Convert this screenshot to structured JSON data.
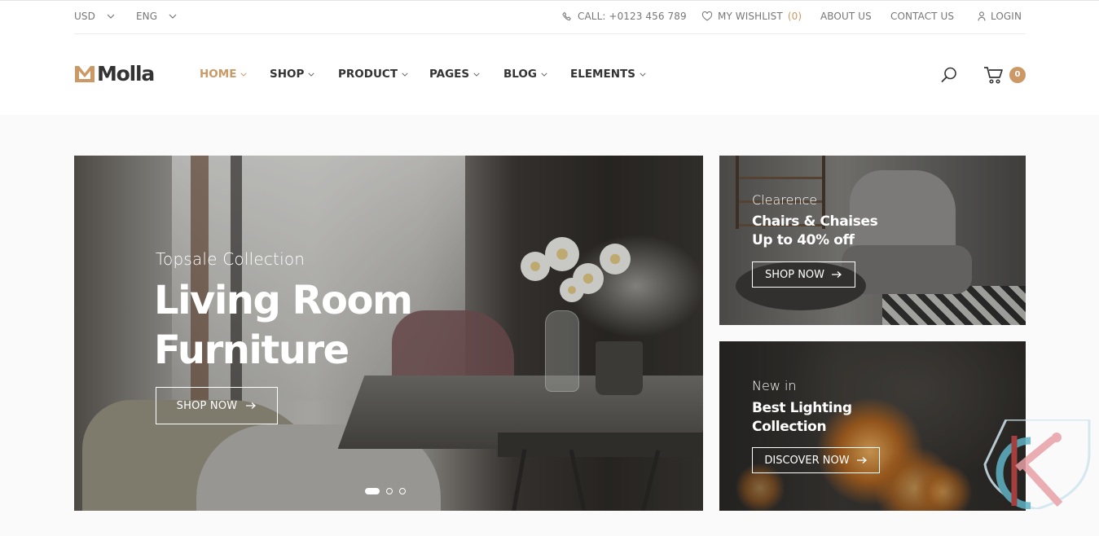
{
  "topbar": {
    "currency": "USD",
    "language": "ENG",
    "call_label": "CALL: +0123 456 789",
    "wishlist_label": "MY WISHLIST",
    "wishlist_count": "(0)",
    "about": "ABOUT US",
    "contact": "CONTACT US",
    "login": "LOGIN"
  },
  "header": {
    "logo_text": "Molla",
    "nav": [
      "HOME",
      "SHOP",
      "PRODUCT",
      "PAGES",
      "BLOG",
      "ELEMENTS"
    ],
    "cart_count": "0"
  },
  "hero": {
    "subtitle": "Topsale Collection",
    "title_line1": "Living Room",
    "title_line2": "Furniture",
    "button": "SHOP NOW",
    "dots_total": 3,
    "dots_active": 1
  },
  "banners": [
    {
      "subtitle": "Clearence",
      "title_line1": "Chairs & Chaises",
      "title_line2": "Up to 40% off",
      "button": "SHOP NOW"
    },
    {
      "subtitle": "New in",
      "title_line1": "Best Lighting",
      "title_line2": "Collection",
      "button": "DISCOVER NOW"
    }
  ],
  "colors": {
    "accent": "#cc9966",
    "text": "#333333"
  },
  "icons": [
    "phone-icon",
    "heart-icon",
    "user-icon",
    "search-icon",
    "cart-icon",
    "arrow-right-icon",
    "chevron-down-icon"
  ]
}
